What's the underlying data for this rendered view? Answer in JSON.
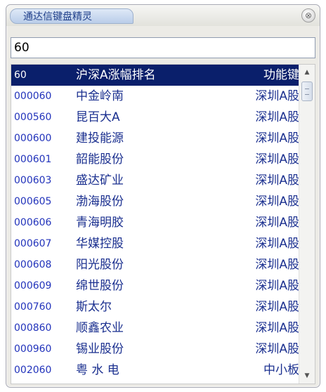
{
  "window": {
    "title": "通达信键盘精灵",
    "close_glyph": "⊗"
  },
  "search": {
    "value": "60"
  },
  "list": {
    "header": {
      "code": "60",
      "name": "沪深A涨幅排名",
      "market": "功能键"
    },
    "rows": [
      {
        "code": "000060",
        "name": "中金岭南",
        "market": "深圳A股"
      },
      {
        "code": "000560",
        "name": "昆百大A",
        "market": "深圳A股"
      },
      {
        "code": "000600",
        "name": "建投能源",
        "market": "深圳A股"
      },
      {
        "code": "000601",
        "name": "韶能股份",
        "market": "深圳A股"
      },
      {
        "code": "000603",
        "name": "盛达矿业",
        "market": "深圳A股"
      },
      {
        "code": "000605",
        "name": "渤海股份",
        "market": "深圳A股"
      },
      {
        "code": "000606",
        "name": "青海明胶",
        "market": "深圳A股"
      },
      {
        "code": "000607",
        "name": "华媒控股",
        "market": "深圳A股"
      },
      {
        "code": "000608",
        "name": "阳光股份",
        "market": "深圳A股"
      },
      {
        "code": "000609",
        "name": "绵世股份",
        "market": "深圳A股"
      },
      {
        "code": "000760",
        "name": "斯太尔",
        "market": "深圳A股"
      },
      {
        "code": "000860",
        "name": "顺鑫农业",
        "market": "深圳A股"
      },
      {
        "code": "000960",
        "name": "锡业股份",
        "market": "深圳A股"
      },
      {
        "code": "002060",
        "name": "粤 水 电",
        "market": "中小板"
      }
    ]
  },
  "scrollbar": {
    "up_glyph": "▲",
    "down_glyph": "▼"
  },
  "colors": {
    "header_bg": "#0a1f6b",
    "row_text": "#1a2f8f",
    "code_text": "#2233bb"
  }
}
